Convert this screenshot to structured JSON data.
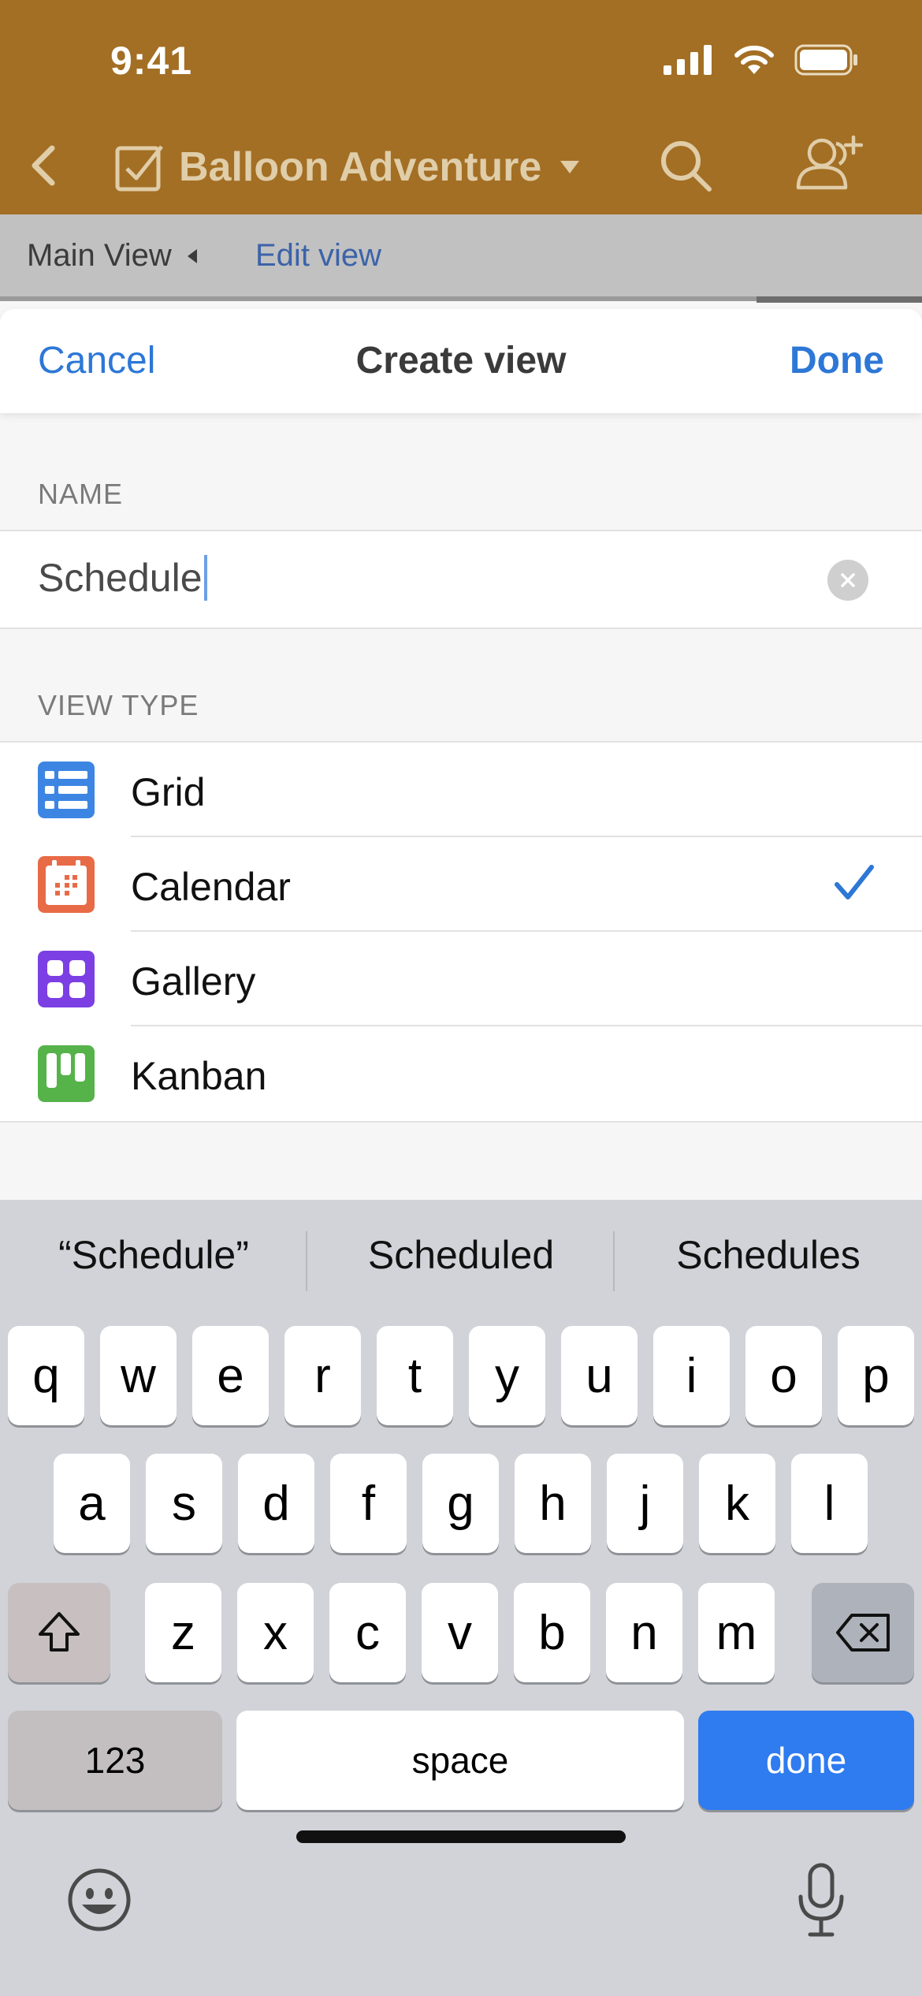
{
  "status_bar": {
    "time": "9:41"
  },
  "nav": {
    "title": "Balloon Adventure"
  },
  "viewbar": {
    "main_view": "Main View",
    "edit_view": "Edit view"
  },
  "sheet": {
    "cancel": "Cancel",
    "title": "Create view",
    "done": "Done",
    "name_label": "NAME",
    "name_value": "Schedule",
    "view_type_label": "VIEW TYPE",
    "types": [
      {
        "label": "Grid",
        "color": "#3d85e3",
        "selected": false
      },
      {
        "label": "Calendar",
        "color": "#e86b47",
        "selected": true
      },
      {
        "label": "Gallery",
        "color": "#7b3fe4",
        "selected": false
      },
      {
        "label": "Kanban",
        "color": "#55b34a",
        "selected": false
      }
    ]
  },
  "keyboard": {
    "suggestions": [
      "“Schedule”",
      "Scheduled",
      "Schedules"
    ],
    "row1": [
      "q",
      "w",
      "e",
      "r",
      "t",
      "y",
      "u",
      "i",
      "o",
      "p"
    ],
    "row2": [
      "a",
      "s",
      "d",
      "f",
      "g",
      "h",
      "j",
      "k",
      "l"
    ],
    "row3": [
      "z",
      "x",
      "c",
      "v",
      "b",
      "n",
      "m"
    ],
    "num_key": "123",
    "space_key": "space",
    "done_key": "done"
  },
  "colors": {
    "app_header": "#a36f24",
    "accent_blue": "#2d77d6",
    "keyboard_done": "#2f7bf0"
  }
}
